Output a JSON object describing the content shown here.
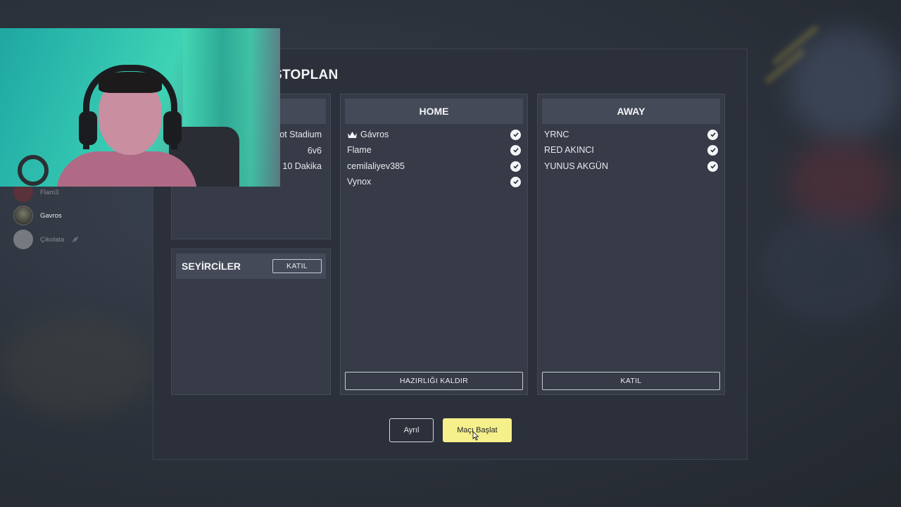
{
  "lobby": {
    "title": "STOPLAN",
    "info": {
      "stadium": "ot Stadium",
      "format": "6v6",
      "duration": "10 Dakika"
    },
    "spectators": {
      "title": "SEYİRCİLER",
      "join_label": "KATIL"
    },
    "home": {
      "title": "HOME",
      "players": [
        {
          "name": "Gávros",
          "host": true,
          "ready": true
        },
        {
          "name": "Flame",
          "host": false,
          "ready": true
        },
        {
          "name": "cemilaliyev385",
          "host": false,
          "ready": true
        },
        {
          "name": "Vynox",
          "host": false,
          "ready": true
        }
      ],
      "button_label": "HAZIRLIĞI KALDIR"
    },
    "away": {
      "title": "AWAY",
      "players": [
        {
          "name": "YRNC",
          "ready": true
        },
        {
          "name": "RED AKINCI",
          "ready": true
        },
        {
          "name": "YUNUS AKGÜN",
          "ready": true
        }
      ],
      "button_label": "KATIL"
    },
    "actions": {
      "leave_label": "Ayrıl",
      "start_label": "Maçı Başlat"
    }
  },
  "friends": [
    {
      "name": "Flam3"
    },
    {
      "name": "Gavros"
    },
    {
      "name": "Çikolata"
    }
  ],
  "colors": {
    "start_button": "#f6f08a",
    "panel": "#363b47",
    "panel_header": "#444a57"
  }
}
